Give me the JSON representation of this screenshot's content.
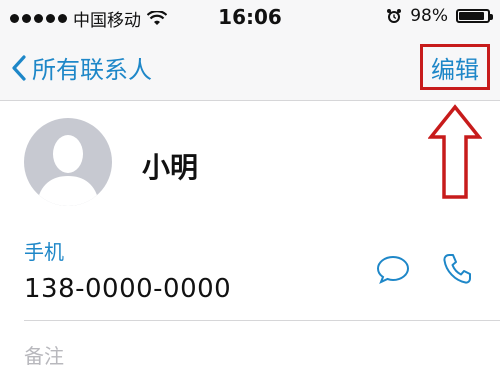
{
  "status": {
    "carrier": "中国移动",
    "time": "16:06",
    "battery": "98%",
    "battery_level": 0.98
  },
  "nav": {
    "back_label": "所有联系人",
    "edit_label": "编辑"
  },
  "contact": {
    "name": "小明"
  },
  "phone": {
    "label": "手机",
    "number": "138-0000-0000"
  },
  "notes": {
    "label": "备注"
  },
  "colors": {
    "accent": "#1e87c8",
    "annotation": "#c71b1b"
  }
}
